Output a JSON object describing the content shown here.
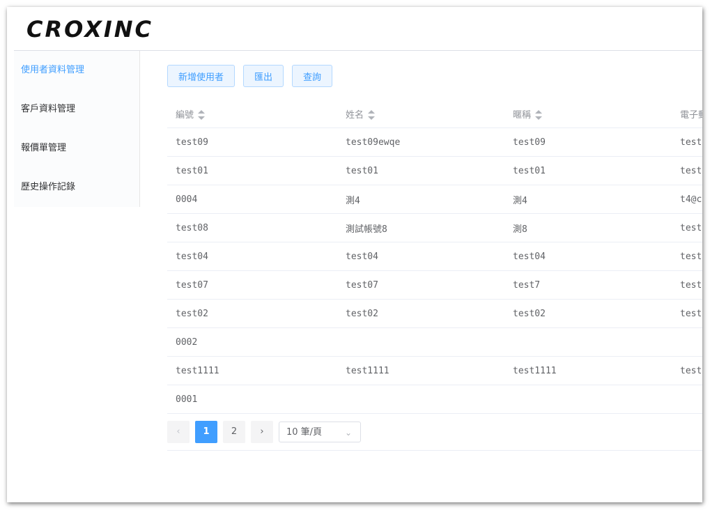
{
  "brand": {
    "logo": "CROXINC"
  },
  "sidebar": {
    "items": [
      {
        "label": "使用者資料管理",
        "active": true
      },
      {
        "label": "客戶資料管理",
        "active": false
      },
      {
        "label": "報價單管理",
        "active": false
      },
      {
        "label": "歷史操作記錄",
        "active": false
      }
    ]
  },
  "toolbar": {
    "add_label": "新增使用者",
    "export_label": "匯出",
    "query_label": "查詢"
  },
  "table": {
    "headers": [
      "編號",
      "姓名",
      "暱稱",
      "電子郵"
    ],
    "rows": [
      [
        "test09",
        "test09ewqe",
        "test09",
        "test"
      ],
      [
        "test01",
        "test01",
        "test01",
        "test"
      ],
      [
        "0004",
        "測4",
        "測4",
        "t4@c"
      ],
      [
        "test08",
        "測試帳號8",
        "測8",
        "test"
      ],
      [
        "test04",
        "test04",
        "test04",
        "test"
      ],
      [
        "test07",
        "test07",
        "test7",
        "test"
      ],
      [
        "test02",
        "test02",
        "test02",
        "test"
      ],
      [
        "0002",
        "",
        "",
        ""
      ],
      [
        "test1111",
        "test1111",
        "test1111",
        "test"
      ],
      [
        "0001",
        "",
        "",
        ""
      ]
    ]
  },
  "pagination": {
    "prev": "‹",
    "next": "›",
    "pages": [
      "1",
      "2"
    ],
    "current": "1",
    "page_size": "10 筆/頁"
  },
  "colors": {
    "accent": "#409eff"
  }
}
